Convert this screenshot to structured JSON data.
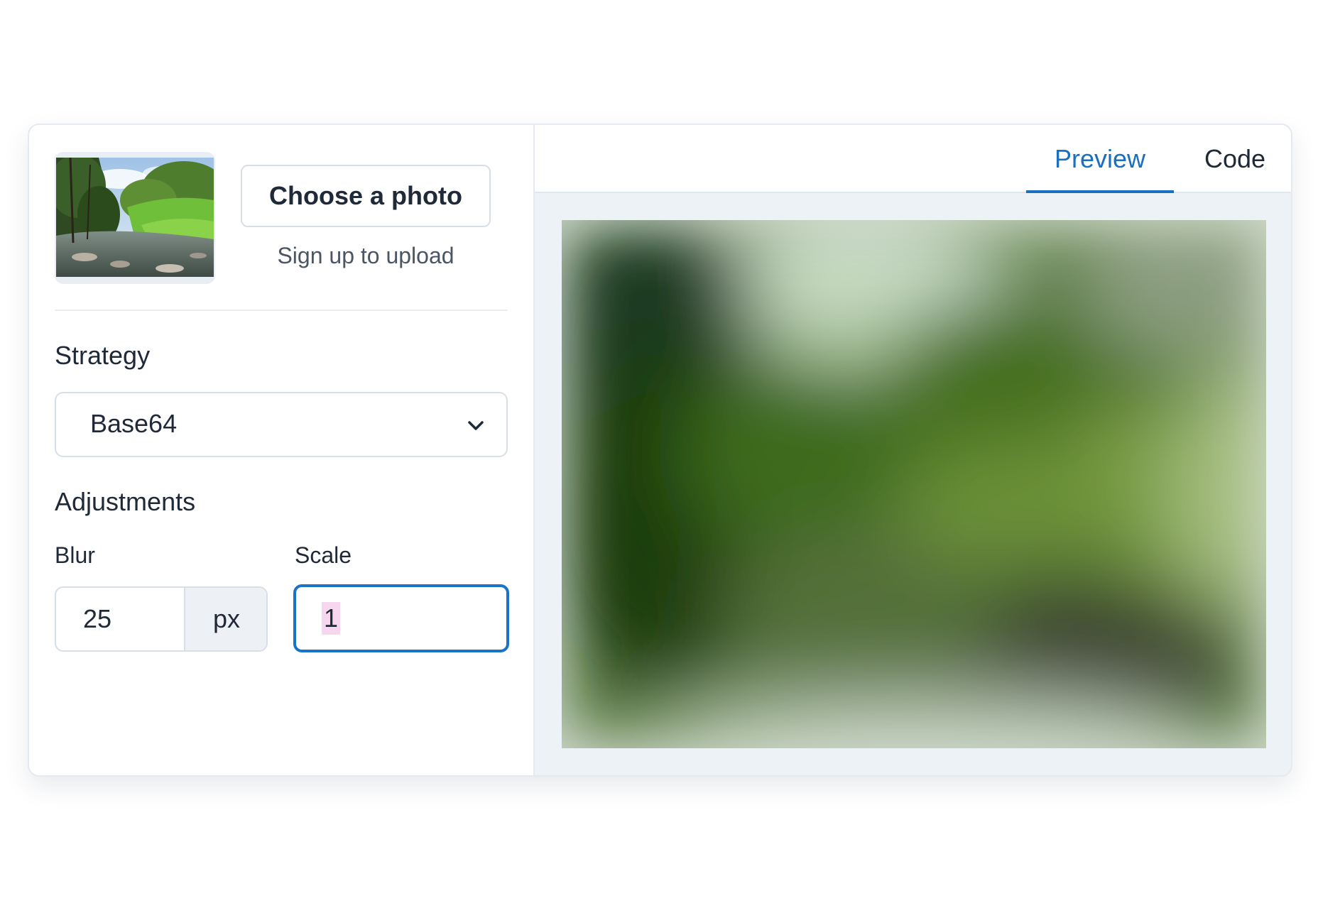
{
  "upload": {
    "choose_label": "Choose a photo",
    "signup_hint": "Sign up to upload",
    "thumbnail_icon": "landscape-photo"
  },
  "strategy": {
    "heading": "Strategy",
    "selected": "Base64"
  },
  "adjustments": {
    "heading": "Adjustments",
    "blur": {
      "label": "Blur",
      "value": "25",
      "unit": "px"
    },
    "scale": {
      "label": "Scale",
      "value": "1"
    }
  },
  "tabs": [
    {
      "label": "Preview",
      "active": true
    },
    {
      "label": "Code",
      "active": false
    }
  ],
  "colors": {
    "accent": "#1a6fbf",
    "focus_border": "#1a73c9",
    "preview_bg": "#edf2f7"
  }
}
